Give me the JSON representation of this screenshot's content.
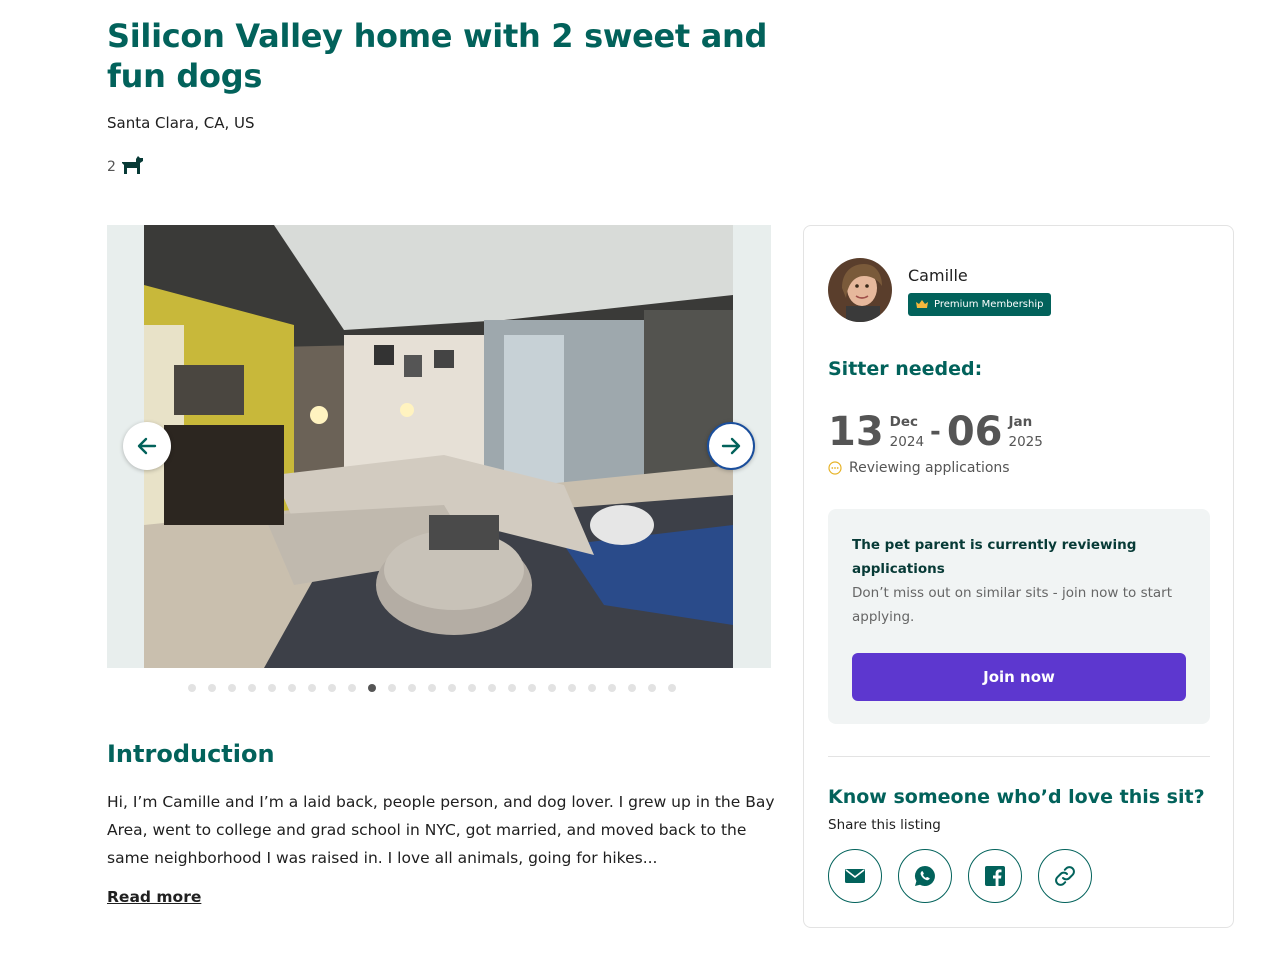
{
  "listing": {
    "title": "Silicon Valley home with 2 sweet and fun dogs",
    "location": "Santa Clara, CA, US",
    "pet_count": "2",
    "pet_icon": "dog-icon"
  },
  "gallery": {
    "total_photos": 25,
    "active_index": 9
  },
  "introduction": {
    "heading": "Introduction",
    "text": "Hi, I’m Camille and I’m a laid back, people person, and dog lover. I grew up in the Bay Area, went to college and grad school in NYC, got married, and moved back to the same neighborhood I was raised in. I love all animals, going for hikes...",
    "read_more": "Read more"
  },
  "owner": {
    "name": "Camille",
    "badge": "Premium Membership"
  },
  "sitter": {
    "heading": "Sitter needed:",
    "start": {
      "day": "13",
      "month": "Dec",
      "year": "2024"
    },
    "end": {
      "day": "06",
      "month": "Jan",
      "year": "2025"
    },
    "separator": "-",
    "status": "Reviewing applications"
  },
  "review_box": {
    "title": "The pet parent is currently reviewing applications",
    "text": "Don’t miss out on similar sits - join now to start applying.",
    "button": "Join now"
  },
  "share": {
    "heading": "Know someone who’d love this sit?",
    "subheading": "Share this listing",
    "buttons": [
      "email-icon",
      "whatsapp-icon",
      "facebook-icon",
      "link-icon"
    ]
  },
  "colors": {
    "brand_green": "#02625b",
    "join_purple": "#5d37cf",
    "status_yellow": "#e7b327"
  }
}
